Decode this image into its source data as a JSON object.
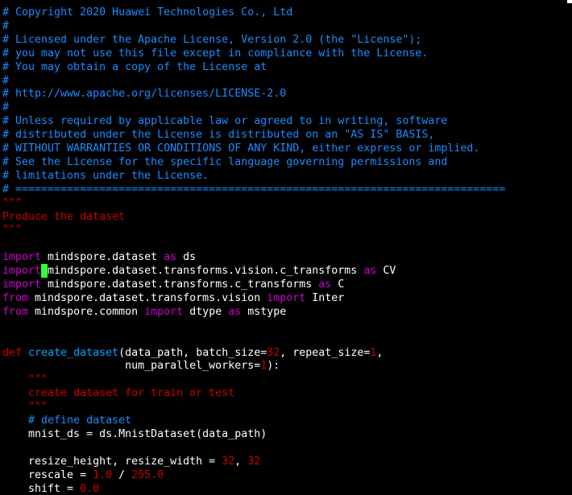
{
  "editor": {
    "lines": [
      [
        {
          "t": "# Copyright 2020 Huawei Technologies Co., Ltd",
          "k": "comment"
        }
      ],
      [
        {
          "t": "#",
          "k": "comment"
        }
      ],
      [
        {
          "t": "# Licensed under the Apache License, Version 2.0 (the \"License\");",
          "k": "comment"
        }
      ],
      [
        {
          "t": "# you may not use this file except in compliance with the License.",
          "k": "comment"
        }
      ],
      [
        {
          "t": "# You may obtain a copy of the License at",
          "k": "comment"
        }
      ],
      [
        {
          "t": "#",
          "k": "comment"
        }
      ],
      [
        {
          "t": "# http://www.apache.org/licenses/LICENSE-2.0",
          "k": "comment"
        }
      ],
      [
        {
          "t": "#",
          "k": "comment"
        }
      ],
      [
        {
          "t": "# Unless required by applicable law or agreed to in writing, software",
          "k": "comment"
        }
      ],
      [
        {
          "t": "# distributed under the License is distributed on an \"AS IS\" BASIS,",
          "k": "comment"
        }
      ],
      [
        {
          "t": "# WITHOUT WARRANTIES OR CONDITIONS OF ANY KIND, either express or implied.",
          "k": "comment"
        }
      ],
      [
        {
          "t": "# See the License for the specific language governing permissions and",
          "k": "comment"
        }
      ],
      [
        {
          "t": "# limitations under the License.",
          "k": "comment"
        }
      ],
      [
        {
          "t": "# ============================================================================",
          "k": "comment"
        }
      ],
      [
        {
          "t": "\"\"\"",
          "k": "string"
        }
      ],
      [
        {
          "t": "Produce the dataset",
          "k": "string"
        }
      ],
      [
        {
          "t": "\"\"\"",
          "k": "string"
        }
      ],
      [],
      [
        {
          "t": "import",
          "k": "keyword"
        },
        {
          "t": " mindspore.dataset ",
          "k": "plain"
        },
        {
          "t": "as",
          "k": "keyword"
        },
        {
          "t": " ds",
          "k": "plain"
        }
      ],
      [
        {
          "t": "import",
          "k": "keyword"
        },
        {
          "t": " ",
          "k": "cursor"
        },
        {
          "t": "mindspore.dataset.transforms.vision.c_transforms ",
          "k": "plain"
        },
        {
          "t": "as",
          "k": "keyword"
        },
        {
          "t": " CV",
          "k": "plain"
        }
      ],
      [
        {
          "t": "import",
          "k": "keyword"
        },
        {
          "t": " mindspore.dataset.transforms.c_transforms ",
          "k": "plain"
        },
        {
          "t": "as",
          "k": "keyword"
        },
        {
          "t": " C",
          "k": "plain"
        }
      ],
      [
        {
          "t": "from",
          "k": "keyword"
        },
        {
          "t": " mindspore.dataset.transforms.vision ",
          "k": "plain"
        },
        {
          "t": "import",
          "k": "keyword"
        },
        {
          "t": " Inter",
          "k": "plain"
        }
      ],
      [
        {
          "t": "from",
          "k": "keyword"
        },
        {
          "t": " mindspore.common ",
          "k": "plain"
        },
        {
          "t": "import",
          "k": "keyword"
        },
        {
          "t": " dtype ",
          "k": "plain"
        },
        {
          "t": "as",
          "k": "keyword"
        },
        {
          "t": " mstype",
          "k": "plain"
        }
      ],
      [],
      [],
      [
        {
          "t": "def",
          "k": "def"
        },
        {
          "t": " ",
          "k": "plain"
        },
        {
          "t": "create_dataset",
          "k": "func"
        },
        {
          "t": "(data_path, batch_size=",
          "k": "plain"
        },
        {
          "t": "32",
          "k": "number"
        },
        {
          "t": ", repeat_size=",
          "k": "plain"
        },
        {
          "t": "1",
          "k": "number"
        },
        {
          "t": ",",
          "k": "plain"
        }
      ],
      [
        {
          "t": "                   num_parallel_workers=",
          "k": "plain"
        },
        {
          "t": "1",
          "k": "number"
        },
        {
          "t": "):",
          "k": "plain"
        }
      ],
      [
        {
          "t": "    ",
          "k": "plain"
        },
        {
          "t": "\"\"\"",
          "k": "string"
        }
      ],
      [
        {
          "t": "    ",
          "k": "plain"
        },
        {
          "t": "create dataset for train or test",
          "k": "string"
        }
      ],
      [
        {
          "t": "    ",
          "k": "plain"
        },
        {
          "t": "\"\"\"",
          "k": "string"
        }
      ],
      [
        {
          "t": "    ",
          "k": "plain"
        },
        {
          "t": "# define dataset",
          "k": "comment"
        }
      ],
      [
        {
          "t": "    mnist_ds = ds.MnistDataset(data_path)",
          "k": "plain"
        }
      ],
      [],
      [
        {
          "t": "    resize_height, resize_width = ",
          "k": "plain"
        },
        {
          "t": "32",
          "k": "number"
        },
        {
          "t": ", ",
          "k": "plain"
        },
        {
          "t": "32",
          "k": "number"
        }
      ],
      [
        {
          "t": "    rescale = ",
          "k": "plain"
        },
        {
          "t": "1.0",
          "k": "number"
        },
        {
          "t": " / ",
          "k": "plain"
        },
        {
          "t": "255.0",
          "k": "number"
        }
      ],
      [
        {
          "t": "    shift = ",
          "k": "plain"
        },
        {
          "t": "0.0",
          "k": "number"
        }
      ]
    ]
  },
  "colors": {
    "background": "#000000",
    "comment": "#1a8cff",
    "string": "#cd0000",
    "keyword": "#cd00cd",
    "function": "#00a5ff",
    "number": "#cd0000",
    "cursor": "#32ff32"
  }
}
